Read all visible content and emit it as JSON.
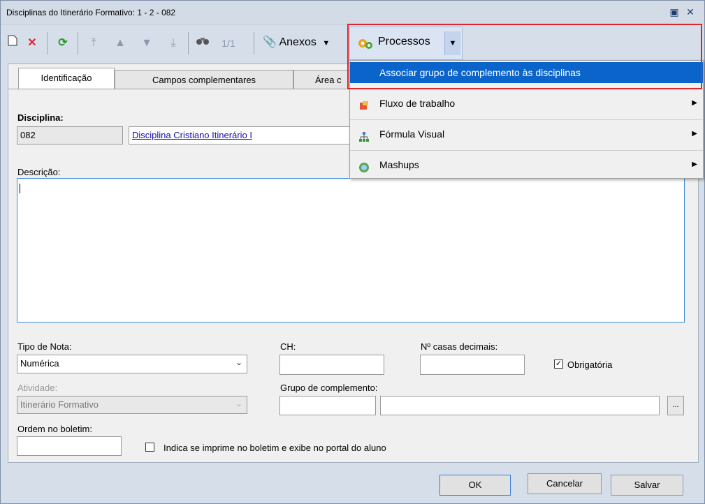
{
  "window": {
    "title": "Disciplinas do Itinerário Formativo: 1 - 2 - 082"
  },
  "toolbar": {
    "record_counter": "1/1",
    "anexos_label": "Anexos",
    "processos_label": "Processos"
  },
  "tabs": [
    {
      "label": "Identificação"
    },
    {
      "label": "Campos complementares"
    },
    {
      "label": "Área c"
    }
  ],
  "form": {
    "disciplina_label": "Disciplina:",
    "disciplina_code": "082",
    "disciplina_name": "Disciplina Cristiano Itinerário I",
    "descricao_label": "Descrição:",
    "tipo_nota_label": "Tipo de Nota:",
    "tipo_nota_value": "Numérica",
    "ch_label": "CH:",
    "casas_label": "Nº casas decimais:",
    "obrigatoria_label": "Obrigatória",
    "atividade_label": "Atividade:",
    "atividade_value": "Itinerário Formativo",
    "grupo_label": "Grupo de complemento:",
    "ordem_label": "Ordem no boletim:",
    "imprime_label": "Indica se imprime no boletim e exibe no portal do aluno",
    "ellipsis_label": "..."
  },
  "footer": {
    "ok_label": "OK",
    "cancelar_label": "Cancelar",
    "salvar_label": "Salvar"
  },
  "dropdown": {
    "items": [
      {
        "label": "Associar grupo de complemento às disciplinas"
      },
      {
        "label": "Fluxo de trabalho"
      },
      {
        "label": "Fórmula Visual"
      },
      {
        "label": "Mashups"
      }
    ]
  },
  "colors": {
    "highlight": "#0a64cc",
    "annotation_box": "#e0242c"
  }
}
